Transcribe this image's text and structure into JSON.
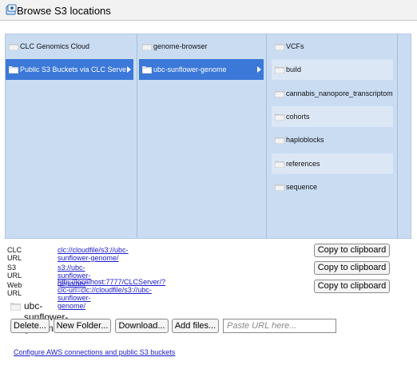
{
  "window": {
    "title": "Browse S3 locations",
    "icon": "s3-browser-icon"
  },
  "columns": [
    {
      "items": [
        {
          "label": "CLC Genomics Cloud",
          "selected": false
        },
        {
          "label": "Public S3 Buckets via CLC Serve",
          "selected": true
        }
      ]
    },
    {
      "items": [
        {
          "label": "genome-browser",
          "selected": false
        },
        {
          "label": "ubc-sunflower-genome",
          "selected": true
        }
      ]
    },
    {
      "items": [
        {
          "label": "VCFs"
        },
        {
          "label": "build"
        },
        {
          "label": "cannabis_nanopore_transcriptome"
        },
        {
          "label": "cohorts"
        },
        {
          "label": "haploblocks"
        },
        {
          "label": "references"
        },
        {
          "label": "sequence"
        }
      ]
    }
  ],
  "urls": {
    "clc": {
      "label": "CLC URL",
      "value": "clc://cloudfile/s3://ubc-sunflower-genome/"
    },
    "s3": {
      "label": "S3 URL",
      "value": "s3://ubc-sunflower-genome/"
    },
    "web": {
      "label": "Web URL",
      "value_line1": "http://localhost:7777/CLCServer/?clc-url=clc://cloudfile/s3://ubc-sunflower-",
      "value_line2": "genome/"
    },
    "copy_label": "Copy to clipboard"
  },
  "current_folder": {
    "name": "ubc-sunflower-genome",
    "icon": "folder-icon"
  },
  "actions": {
    "delete": "Delete...",
    "new_folder": "New Folder...",
    "download": "Download...",
    "add_files": "Add files...",
    "paste_placeholder": "Paste URL here..."
  },
  "footer": {
    "config_link": "Configure AWS connections and public S3 buckets"
  },
  "colors": {
    "selection": "#3b78d8",
    "panel": "#c9dcf2",
    "link": "#1a1acd"
  }
}
